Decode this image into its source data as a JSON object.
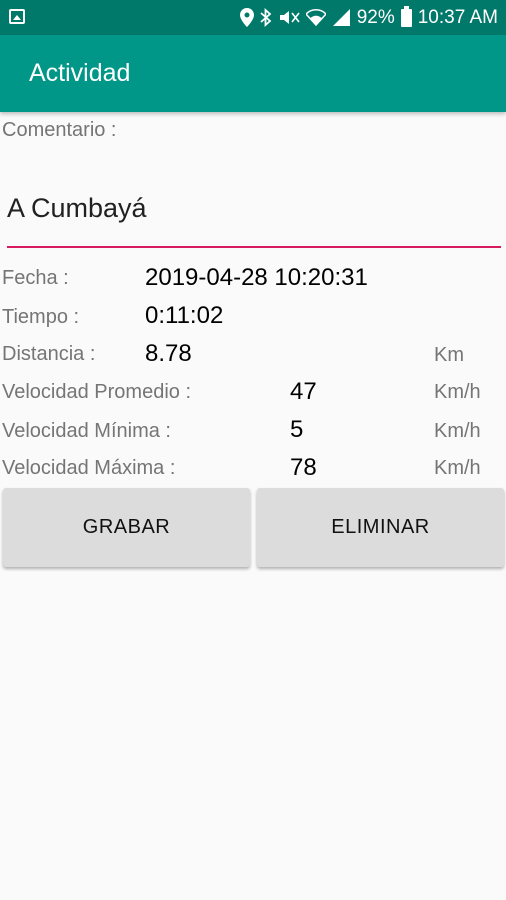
{
  "status_bar": {
    "battery": "92%",
    "time": "10:37 AM"
  },
  "app_bar": {
    "title": "Actividad"
  },
  "form": {
    "comment_label": "Comentario :",
    "comment_value": "A Cumbayá",
    "fields": [
      {
        "label": "Fecha :",
        "value": "2019-04-28 10:20:31"
      },
      {
        "label": "Tiempo :",
        "value": "0:11:02"
      },
      {
        "label": "Distancia :",
        "value": "8.78",
        "unit": "Km"
      },
      {
        "label": "Velocidad Promedio :",
        "value": "47",
        "unit": "Km/h"
      },
      {
        "label": "Velocidad Mínima :",
        "value": "5",
        "unit": "Km/h"
      },
      {
        "label": "Velocidad Máxima :",
        "value": "78",
        "unit": "Km/h"
      }
    ]
  },
  "buttons": {
    "save": "GRABAR",
    "delete": "ELIMINAR"
  }
}
